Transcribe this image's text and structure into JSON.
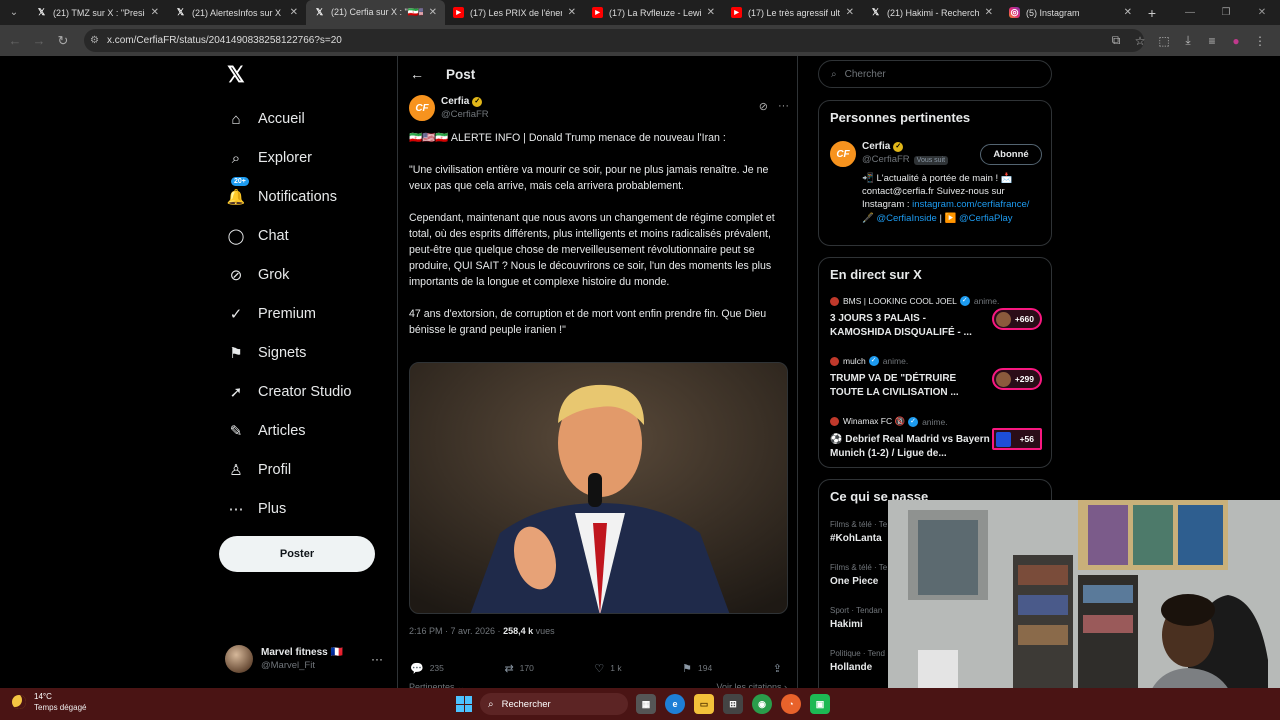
{
  "browser": {
    "tabs": [
      {
        "title": "(21) TMZ sur X : \"Preside",
        "icon": "x-icon",
        "kind": "x",
        "active": false
      },
      {
        "title": "(21) AlertesInfos sur X : \"",
        "icon": "x-icon",
        "kind": "x",
        "active": false
      },
      {
        "title": "(21) Cerfia sur X : \"🇮🇷🇺🇸",
        "icon": "x-icon",
        "kind": "x",
        "active": true
      },
      {
        "title": "(17) Les PRIX de l'énergie",
        "icon": "youtube-icon",
        "kind": "yt",
        "active": false
      },
      {
        "title": "(17) La Rvfleuze - Lewis H",
        "icon": "youtube-icon",
        "kind": "yt",
        "active": false
      },
      {
        "title": "(17) Le très agressif ultim",
        "icon": "youtube-icon",
        "kind": "yt",
        "active": false
      },
      {
        "title": "(21) Hakimi - Recherche /",
        "icon": "x-icon",
        "kind": "x",
        "active": false
      },
      {
        "title": "(5) Instagram",
        "icon": "instagram-icon",
        "kind": "ig",
        "active": false
      }
    ],
    "url": "x.com/CerfiaFR/status/2041490838258122766?s=20"
  },
  "nav": {
    "logo": "𝕏",
    "items": [
      {
        "label": "Accueil",
        "icon": "home-icon",
        "glyph": "⌂"
      },
      {
        "label": "Explorer",
        "icon": "search-icon",
        "glyph": "⌕"
      },
      {
        "label": "Notifications",
        "icon": "bell-icon",
        "glyph": "🔔",
        "badge": "20+"
      },
      {
        "label": "Chat",
        "icon": "chat-icon",
        "glyph": "◯"
      },
      {
        "label": "Grok",
        "icon": "grok-icon",
        "glyph": "⊘"
      },
      {
        "label": "Premium",
        "icon": "premium-icon",
        "glyph": "✓"
      },
      {
        "label": "Signets",
        "icon": "bookmark-icon",
        "glyph": "⚑"
      },
      {
        "label": "Creator Studio",
        "icon": "rocket-icon",
        "glyph": "➚"
      },
      {
        "label": "Articles",
        "icon": "articles-icon",
        "glyph": "✎"
      },
      {
        "label": "Profil",
        "icon": "profile-icon",
        "glyph": "♙"
      },
      {
        "label": "Plus",
        "icon": "more-icon",
        "glyph": "⋯"
      }
    ],
    "post_button": "Poster",
    "account": {
      "name": "Marvel fitness 🇫🇷",
      "handle": "@Marvel_Fit"
    }
  },
  "post": {
    "header_title": "Post",
    "author_name": "Cerfia",
    "author_handle": "@CerfiaFR",
    "paragraphs": [
      "🇮🇷🇺🇸🇮🇷 ALERTE INFO | Donald Trump menace de nouveau l'Iran :",
      "\"Une civilisation entière va mourir ce soir, pour ne plus jamais renaître. Je ne veux pas que cela arrive, mais cela arrivera probablement.",
      "Cependant, maintenant que nous avons un changement de régime complet et total, où des esprits différents, plus intelligents et moins radicalisés prévalent, peut-être que quelque chose de merveilleusement révolutionnaire peut se produire, QUI SAIT ? Nous le découvrirons ce soir, l'un des moments les plus importants de la longue et complexe histoire du monde.",
      "47 ans d'extorsion, de corruption et de mort vont enfin prendre fin. Que Dieu bénisse le grand peuple iranien !\""
    ],
    "time": "2:16 PM · 7 avr. 2026 · ",
    "views_count": "258,4 k",
    "views_label": " vues",
    "replies": "235",
    "reposts": "170",
    "likes": "1 k",
    "bookmarks": "194",
    "peek_left": "Pertinentes ⌄",
    "peek_right": "Voir les citations ›"
  },
  "right": {
    "search_placeholder": "Chercher",
    "relevant": {
      "title": "Personnes pertinentes",
      "name": "Cerfia",
      "handle": "@CerfiaFR",
      "follows_you": "Vous suit",
      "button": "Abonné",
      "bio_1": "📲 L'actualité à portée de main ! 📩 contact@cerfia.fr Suivez-nous sur Instagram : ",
      "bio_link_1": "instagram.com/cerfiafrance/",
      "bio_2": " 🖋️ ",
      "bio_link_2": "@CerfiaInside",
      "bio_3": " | ▶️ ",
      "bio_link_3": "@CerfiaPlay"
    },
    "live": {
      "title": "En direct sur X",
      "items": [
        {
          "host": "BMS | LOOKING COOL JOEL",
          "anim": "anime.",
          "title": "3 JOURS 3 PALAIS - KAMOSHIDA DISQUALIFÉ - ...",
          "count": "+660",
          "square": false
        },
        {
          "host": "mulch",
          "anim": "anime.",
          "title": "TRUMP VA DE \"DÉTRUIRE TOUTE LA CIVILISATION ...",
          "count": "+299",
          "square": false
        },
        {
          "host": "Winamax FC 🔞",
          "anim": "anime.",
          "title": "⚽ Debrief Real Madrid vs Bayern Munich (1-2) / Ligue de...",
          "count": "+56",
          "square": true
        }
      ]
    },
    "trends": {
      "title": "Ce qui se passe",
      "items": [
        {
          "category": "Films & télé · Te",
          "name": "#KohLanta"
        },
        {
          "category": "Films & télé · Te",
          "name": "One Piece"
        },
        {
          "category": "Sport · Tendan",
          "name": "Hakimi"
        },
        {
          "category": "Politique · Tend",
          "name": "Hollande"
        }
      ]
    }
  },
  "taskbar": {
    "temp": "14°C",
    "weather": "Temps dégagé",
    "search": "Rechercher"
  }
}
